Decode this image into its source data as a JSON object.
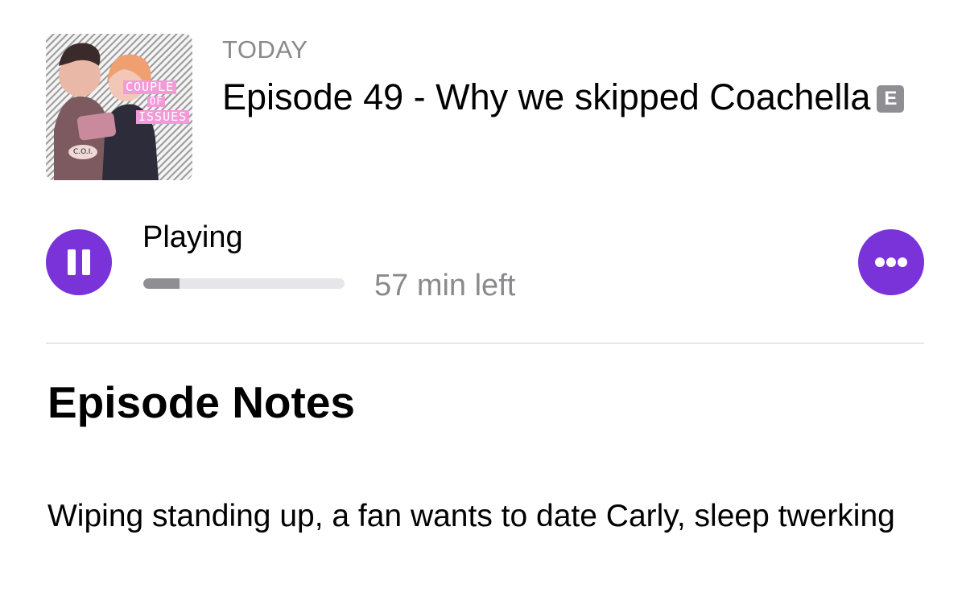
{
  "episode": {
    "date_label": "TODAY",
    "title": "Episode 49 - Why we skipped Coachella",
    "explicit_badge": "E",
    "artwork": {
      "line1": "COUPLE",
      "line2": "OF",
      "line3": "ISSUES",
      "logo": "C.O.I."
    }
  },
  "player": {
    "status": "Playing",
    "time_left": "57 min left",
    "progress_fraction": 0.18,
    "pause_icon": "pause-icon",
    "more_icon": "ellipsis-icon",
    "accent_color": "#7a33d8"
  },
  "notes": {
    "heading": "Episode Notes",
    "body": "Wiping standing up, a fan wants to date Carly, sleep twerking"
  }
}
